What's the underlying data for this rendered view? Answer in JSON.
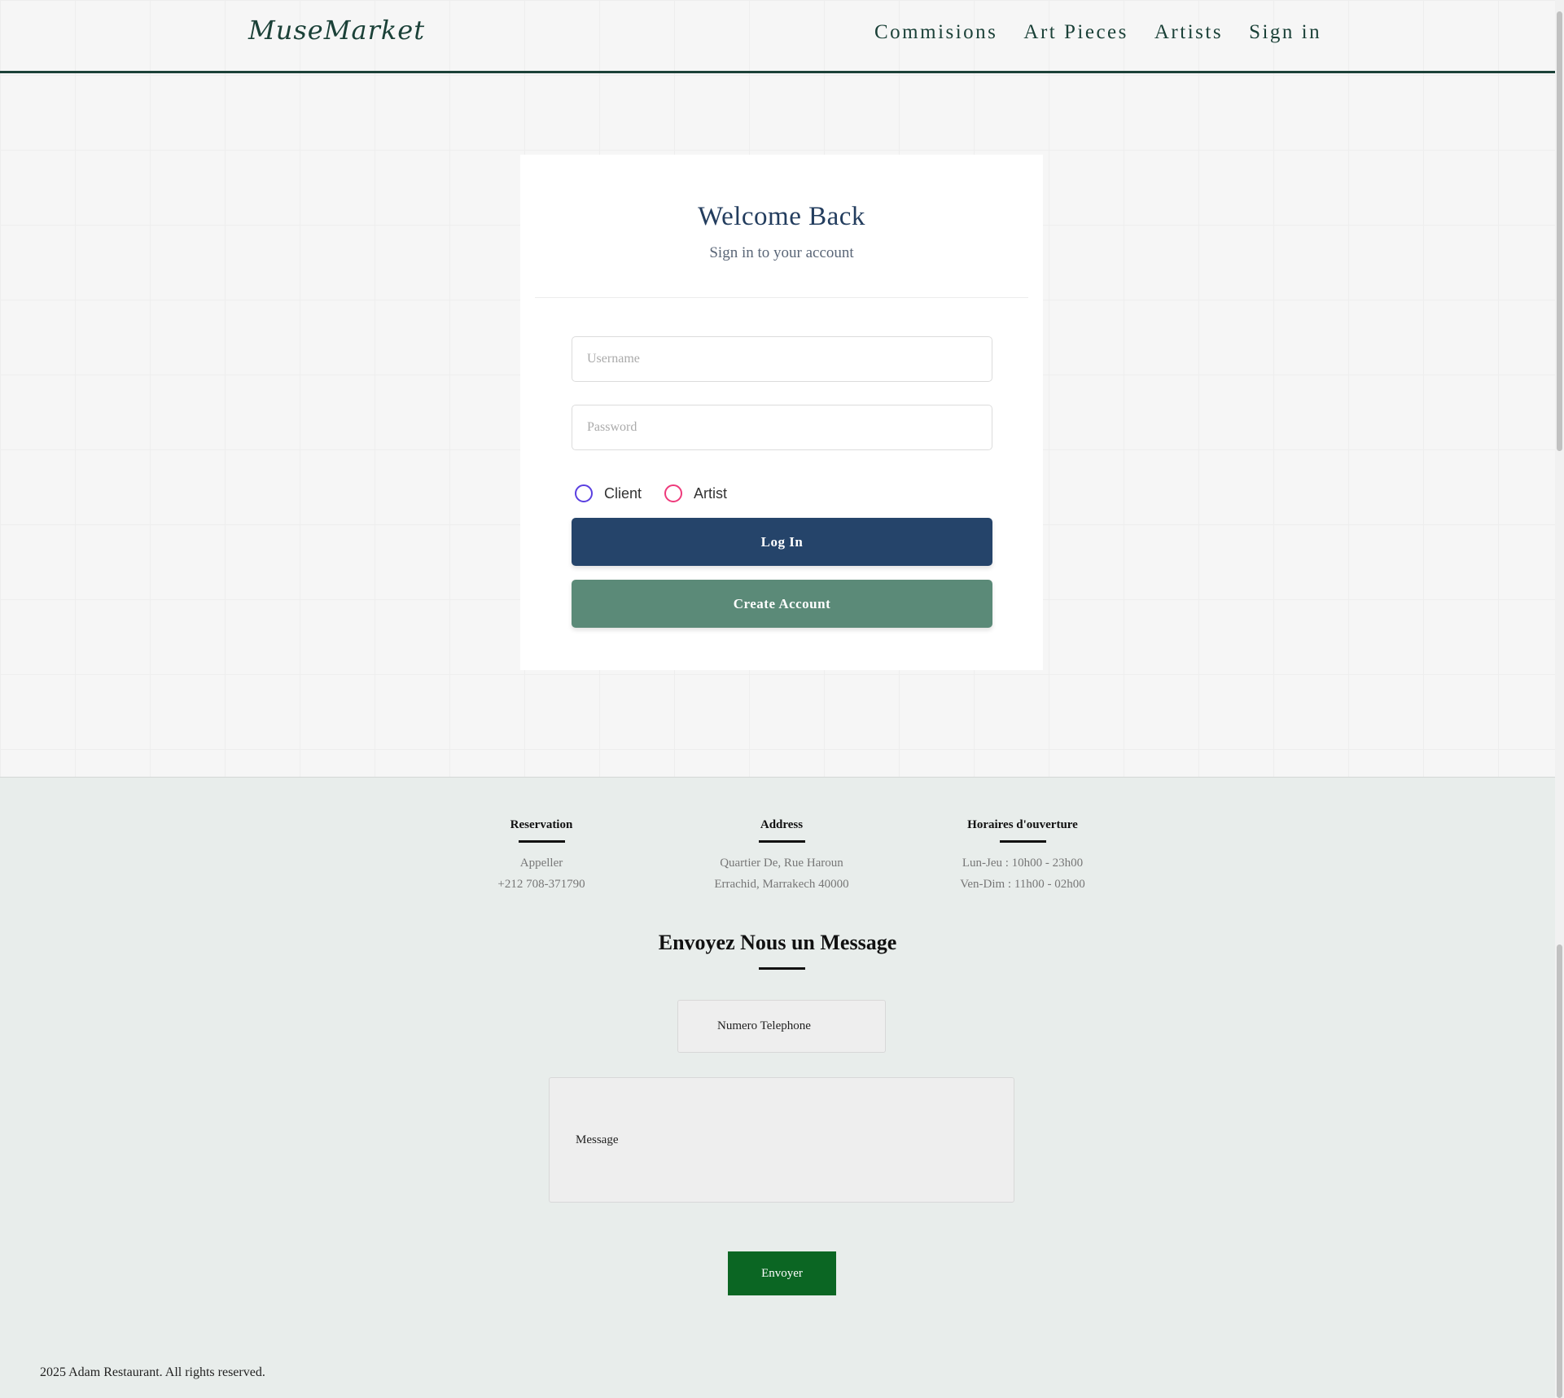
{
  "header": {
    "logo": "MuseMarket",
    "nav": [
      "Commisions",
      "Art Pieces",
      "Artists",
      "Sign in"
    ]
  },
  "login": {
    "title": "Welcome Back",
    "subtitle": "Sign in to your account",
    "username_placeholder": "Username",
    "password_placeholder": "Password",
    "roles": [
      {
        "label": "Client",
        "color": "#5a3fe0",
        "selected": false
      },
      {
        "label": "Artist",
        "color": "#ee3a7b",
        "selected": false
      }
    ],
    "login_label": "Log In",
    "create_label": "Create Account",
    "login_color": "#25446a",
    "create_color": "#5b8a78"
  },
  "footer": {
    "columns": [
      {
        "heading": "Reservation",
        "lines": [
          "Appeller",
          "+212 708-371790"
        ]
      },
      {
        "heading": "Address",
        "lines": [
          "Quartier De, Rue Haroun",
          "Errachid, Marrakech 40000"
        ]
      },
      {
        "heading": "Horaires d'ouverture",
        "lines": [
          "Lun-Jeu : 10h00 - 23h00",
          "Ven-Dim : 11h00 - 02h00"
        ]
      }
    ],
    "message_title": "Envoyez Nous un Message",
    "phone_placeholder": "Numero Telephone",
    "message_placeholder": "Message",
    "send_label": "Envoyer",
    "send_color": "#0b6623",
    "copyright": "2025 Adam Restaurant. All rights reserved."
  }
}
